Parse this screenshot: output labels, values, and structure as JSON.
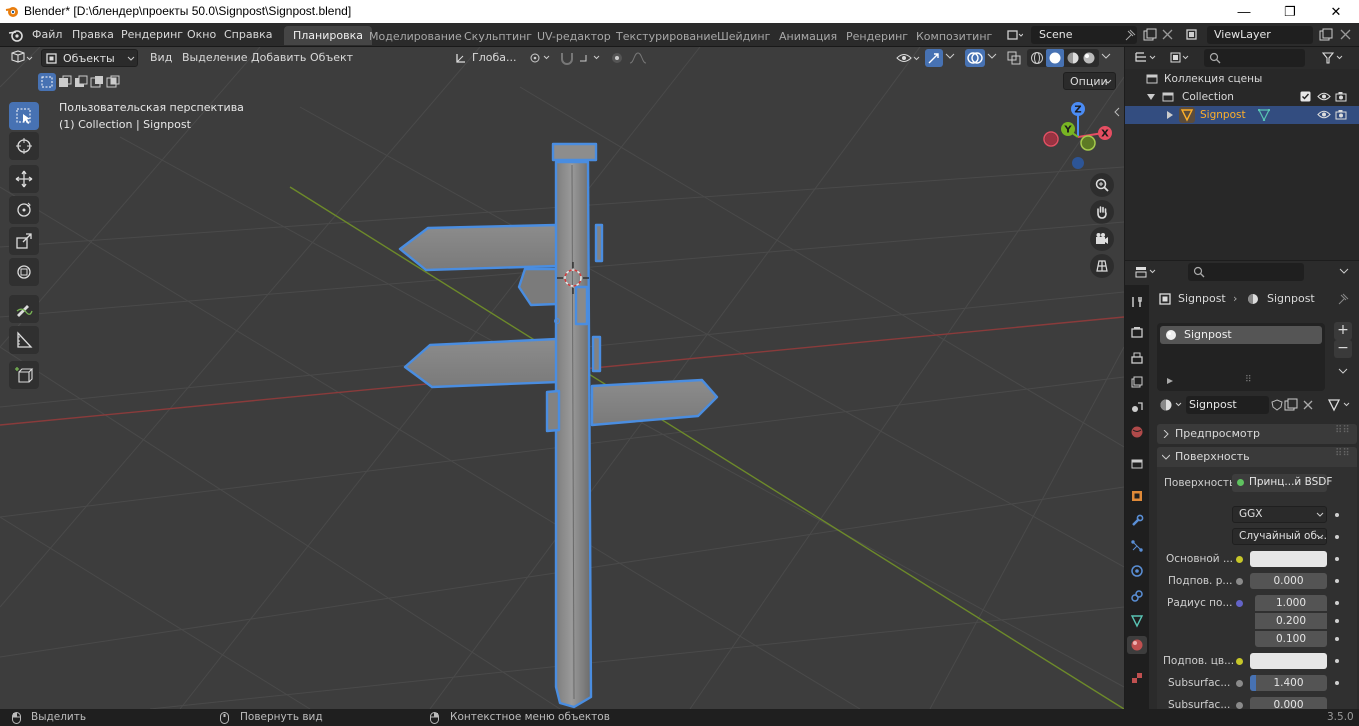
{
  "window": {
    "title": "Blender* [D:\\блендер\\проекты 50.0\\Signpost\\Signpost.blend]",
    "minimize": "—",
    "maximize": "❐",
    "close": "✕"
  },
  "topbar": {
    "menus": [
      "Файл",
      "Правка",
      "Рендеринг",
      "Окно",
      "Справка"
    ],
    "workspaces": [
      "Планировка",
      "Моделирование",
      "Скульптинг",
      "UV-редактор",
      "Текстурирование",
      "Шейдинг",
      "Анимация",
      "Рендеринг",
      "Композитинг"
    ],
    "active_workspace": "Планировка",
    "scene": "Scene",
    "view_layer": "ViewLayer"
  },
  "viewport": {
    "mode": "Объекты",
    "menus": [
      "Вид",
      "Выделение",
      "Добавить",
      "Объект"
    ],
    "transform_orientation": "Глоба...",
    "options_label": "Опции",
    "overlay_line1": "Пользовательская перспектива",
    "overlay_line2": "(1) Collection | Signpost",
    "gizmo": {
      "x": "X",
      "y": "Y",
      "z": "Z"
    }
  },
  "outliner": {
    "scene_collection": "Коллекция сцены",
    "collection": "Collection",
    "object": "Signpost"
  },
  "properties": {
    "breadcrumb_object": "Signpost",
    "breadcrumb_material": "Signpost",
    "material_slot": "Signpost",
    "material_name": "Signpost",
    "panel_preview": "Предпросмотр",
    "panel_surface": "Поверхность",
    "surface_label": "Поверхность",
    "surface_shader": "Принц...й BSDF",
    "distribution": "GGX",
    "subsurface_method": "Случайный об...",
    "rows": [
      {
        "label": "Основной ...",
        "value": ""
      },
      {
        "label": "Подпов. р...",
        "value": "0.000"
      },
      {
        "label": "Радиус по...",
        "value": "1.000"
      },
      {
        "label": "",
        "value": "0.200"
      },
      {
        "label": "",
        "value": "0.100"
      },
      {
        "label": "Подпов. цв...",
        "value": ""
      },
      {
        "label": "Subsurfac...",
        "value": "1.400"
      },
      {
        "label": "Subsurfac...",
        "value": "0.000"
      }
    ]
  },
  "statusbar": {
    "left": "Выделить",
    "middle": "Повернуть вид",
    "right": "Контекстное меню объектов",
    "version": "3.5.0"
  },
  "colors": {
    "accent": "#4772b3",
    "selection_outline": "#4a8de0",
    "active_object": "#ffaf29"
  }
}
